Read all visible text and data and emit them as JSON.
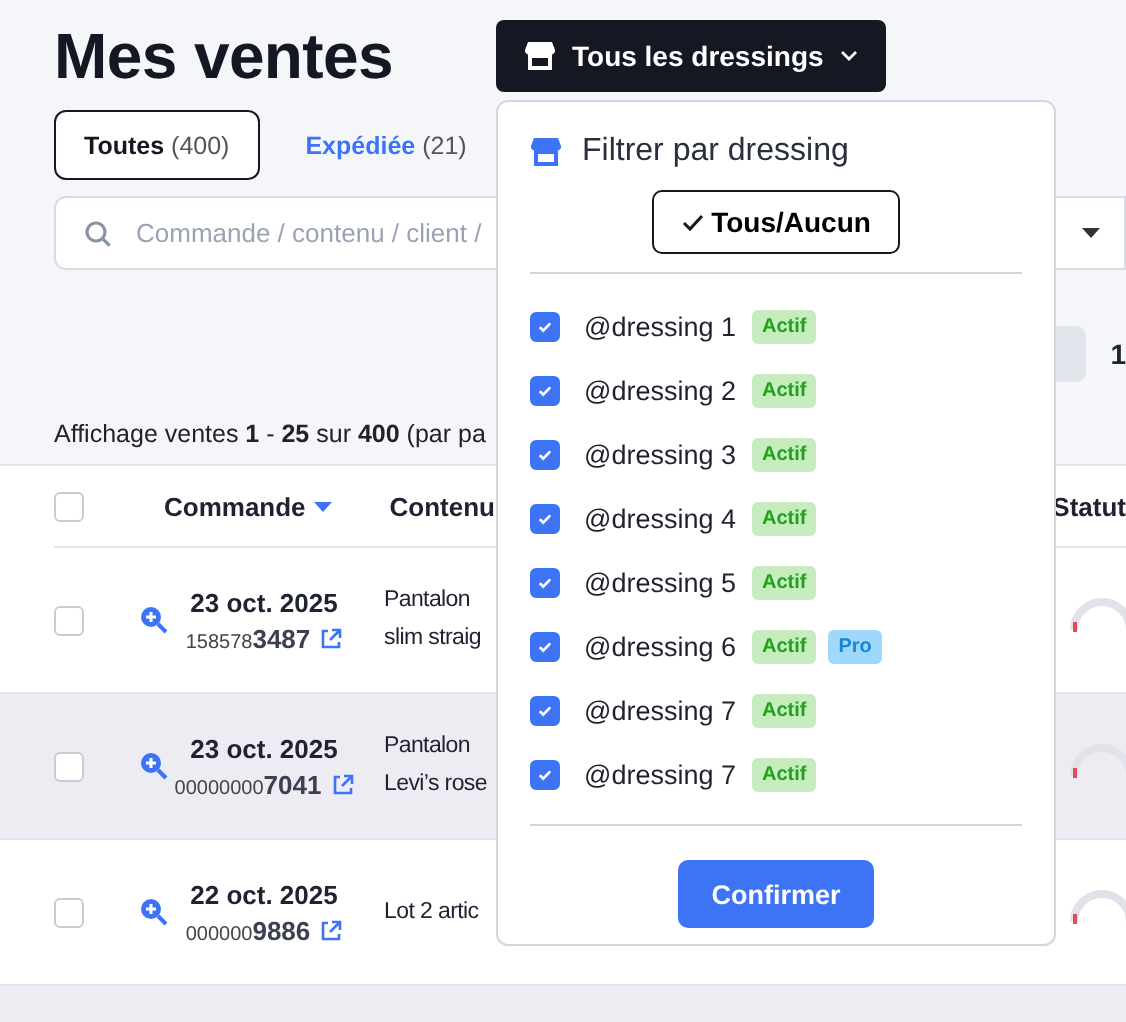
{
  "header": {
    "title": "Mes ventes",
    "store_button": {
      "label": "Tous les dressings"
    }
  },
  "tabs": [
    {
      "label": "Toutes",
      "count": "(400)",
      "selected": true
    },
    {
      "label": "Expédiée",
      "count": "(21)",
      "selected": false
    }
  ],
  "search": {
    "placeholder": "Commande / contenu / client /"
  },
  "pagination": {
    "page": "1"
  },
  "summary": "Affichage ventes **1** - **25** sur **400**  (par pa",
  "table": {
    "select_all_checked": false,
    "columns": [
      {
        "label": "Commande",
        "sorted": true
      },
      {
        "label": "Contenu",
        "sorted": false
      },
      {
        "label": "Statut",
        "sorted": false
      }
    ],
    "rows": [
      {
        "date": "23 oct. 2025",
        "order_prefix": "158578",
        "order_suffix": "3487",
        "content": [
          "Pantalon",
          "slim straig"
        ],
        "checked": false,
        "highlighted": false
      },
      {
        "date": "23 oct. 2025",
        "order_prefix": "00000000",
        "order_suffix": "7041",
        "content": [
          "Pantalon",
          "Levi’s rose"
        ],
        "checked": false,
        "highlighted": true
      },
      {
        "date": "22 oct. 2025",
        "order_prefix": "000000",
        "order_suffix": "9886",
        "content": [
          "Lot 2 artic"
        ],
        "checked": false,
        "highlighted": false
      },
      {
        "highlighted": true
      }
    ]
  },
  "dropdown": {
    "title": "Filtrer par dressing",
    "toggle_all": "Tous/Aucun",
    "items": [
      {
        "name": "@dressing 1",
        "checked": true,
        "badges": [
          {
            "label": "Actif",
            "kind": "active"
          }
        ]
      },
      {
        "name": "@dressing 2",
        "checked": true,
        "badges": [
          {
            "label": "Actif",
            "kind": "active"
          }
        ]
      },
      {
        "name": "@dressing 3",
        "checked": true,
        "badges": [
          {
            "label": "Actif",
            "kind": "active"
          }
        ]
      },
      {
        "name": "@dressing 4",
        "checked": true,
        "badges": [
          {
            "label": "Actif",
            "kind": "active"
          }
        ]
      },
      {
        "name": "@dressing 5",
        "checked": true,
        "badges": [
          {
            "label": "Actif",
            "kind": "active"
          }
        ]
      },
      {
        "name": "@dressing 6",
        "checked": true,
        "badges": [
          {
            "label": "Actif",
            "kind": "active"
          },
          {
            "label": "Pro",
            "kind": "pro"
          }
        ]
      },
      {
        "name": "@dressing 7",
        "checked": true,
        "badges": [
          {
            "label": "Actif",
            "kind": "active"
          }
        ]
      },
      {
        "name": "@dressing 7",
        "checked": true,
        "badges": [
          {
            "label": "Actif",
            "kind": "active"
          }
        ]
      }
    ],
    "confirm": "Confirmer"
  }
}
